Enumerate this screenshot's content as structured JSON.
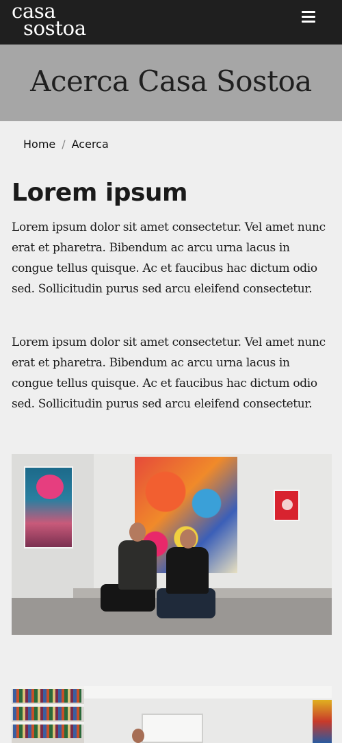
{
  "header": {
    "logo_line1": "casa",
    "logo_line2": "sostoa",
    "menu_icon": "hamburger-menu-icon"
  },
  "banner": {
    "title": "Acerca Casa Sostoa"
  },
  "breadcrumb": {
    "items": [
      "Home",
      "Acerca"
    ],
    "separator": "/"
  },
  "content": {
    "heading": "Lorem ipsum",
    "paragraphs": [
      "Lorem ipsum dolor sit amet consectetur. Vel amet nunc erat et pharetra. Bibendum ac arcu urna lacus in congue tellus quisque. Ac et faucibus hac dictum odio sed. Sollicitudin purus sed arcu eleifend consectetur.",
      "Lorem ipsum dolor sit amet consectetur. Vel amet nunc erat et pharetra. Bibendum ac arcu urna lacus in congue tellus quisque. Ac et faucibus hac dictum odio sed. Sollicitudin purus sed arcu eleifend consectetur."
    ]
  },
  "colors": {
    "header_bg": "#1f1f1f",
    "banner_bg": "#a6a6a6",
    "page_bg": "#efefef",
    "text": "#1a1a1a"
  }
}
